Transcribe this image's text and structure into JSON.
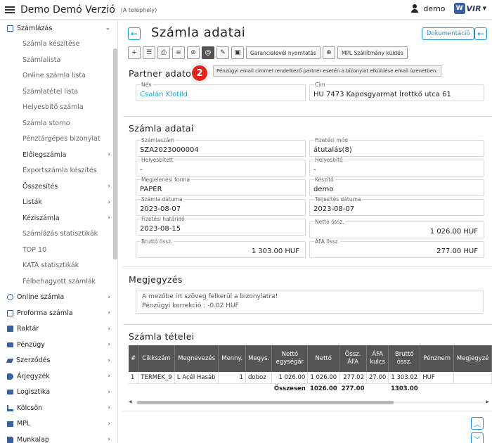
{
  "header": {
    "title": "Demo Demó Verzió",
    "subtitle": "(A telephely)",
    "user": "demo",
    "logo_text": "VIR",
    "logo_letter": "W"
  },
  "sidebar": {
    "items": [
      {
        "label": "Számlázás",
        "icon": "document-icon",
        "chevron": "⌄",
        "type": "main"
      },
      {
        "label": "Számla készítése",
        "type": "sub"
      },
      {
        "label": "Számlalista",
        "type": "sub"
      },
      {
        "label": "Online számla lista",
        "type": "sub"
      },
      {
        "label": "Számlatétel lista",
        "type": "sub"
      },
      {
        "label": "Helyesbítő számla",
        "type": "sub"
      },
      {
        "label": "Számla storno",
        "type": "sub"
      },
      {
        "label": "Pénztárgépes bizonylat",
        "type": "sub"
      },
      {
        "label": "Előlegszámla",
        "chevron": "›",
        "type": "subbold"
      },
      {
        "label": "Exportszámla készítés",
        "type": "sub"
      },
      {
        "label": "Összesítés",
        "chevron": "›",
        "type": "subbold"
      },
      {
        "label": "Listák",
        "chevron": "›",
        "type": "subbold"
      },
      {
        "label": "Kéziszámla",
        "chevron": "›",
        "type": "subbold"
      },
      {
        "label": "Számlázás statisztikák",
        "type": "sub"
      },
      {
        "label": "TOP 10",
        "type": "sub"
      },
      {
        "label": "KATA statisztikák",
        "type": "sub"
      },
      {
        "label": "Félbehagyott számlák",
        "type": "sub"
      },
      {
        "label": "Online számla",
        "icon": "globe-icon",
        "chevron": "›",
        "type": "main"
      },
      {
        "label": "Proforma számla",
        "icon": "document-icon",
        "chevron": "›",
        "type": "main"
      },
      {
        "label": "Raktár",
        "icon": "warehouse-icon",
        "chevron": "›",
        "type": "main"
      },
      {
        "label": "Pénzügy",
        "icon": "money-icon",
        "chevron": "›",
        "type": "main"
      },
      {
        "label": "Szerződés",
        "icon": "pen-icon",
        "chevron": "›",
        "type": "main"
      },
      {
        "label": "Árjegyzék",
        "icon": "tag-icon",
        "chevron": "›",
        "type": "main"
      },
      {
        "label": "Logisztika",
        "icon": "truck-icon",
        "chevron": "›",
        "type": "main"
      },
      {
        "label": "Kölcsön",
        "icon": "hand-icon",
        "chevron": "›",
        "type": "main"
      },
      {
        "label": "MPL",
        "icon": "map-icon",
        "chevron": "›",
        "type": "main"
      },
      {
        "label": "Munkalap",
        "icon": "folder-icon",
        "chevron": "›",
        "type": "main"
      }
    ]
  },
  "page": {
    "title": "Számla adatai",
    "doc_button": "Dokumentáció",
    "back_arrow": "←",
    "toolbar": {
      "plus": "+",
      "list": "☰",
      "print": "⎙",
      "numbered": "≡",
      "cancel": "⊘",
      "email": "@",
      "edit": "✎",
      "money": "▣",
      "guarantee": "Garancialevél nyomtatás",
      "globe": "⊕",
      "mpl": "MPL Szállítmány küldés"
    },
    "tooltip": "Pénzügyi email címmel rendelkező partner esetén a bizonylat elküldése email üzenetben.",
    "badge": "2"
  },
  "partner": {
    "title": "Partner adato",
    "name_label": "Név",
    "name": "Csalán Klotild",
    "address_label": "Cím",
    "address": "HU 7473 Kaposgyarmat Írottkő utca 61"
  },
  "invoice": {
    "title": "Számla adatai",
    "fields": {
      "szamlaszam_label": "Számlaszám",
      "szamlaszam": "SZA2023000004",
      "fizetesi_mod_label": "Fizetési mód",
      "fizetesi_mod": "átutalás(8)",
      "helyesbitett_label": "Helyesbített",
      "helyesbitett": "-",
      "helyesbito_label": "Helyesbítő",
      "helyesbito": "-",
      "megjelenesi_label": "Megjelenési forma",
      "megjelenesi": "PAPER",
      "keszito_label": "Készítő",
      "keszito": "demo",
      "datum_label": "Számla dátuma",
      "datum": "2023-08-07",
      "teljesites_label": "Teljesítés dátuma",
      "teljesites": "2023-08-07",
      "hatarido_label": "Fizetési határidő",
      "hatarido": "2023-08-15",
      "netto_label": "Nettó össz.",
      "netto": "1 026.00 HUF",
      "brutto_label": "Bruttó össz.",
      "brutto": "1 303.00 HUF",
      "afa_label": "ÁFA össz.",
      "afa": "277.00 HUF"
    }
  },
  "notes": {
    "title": "Megjegyzés",
    "line1": "A mezőbe írt szöveg felkerül a bizonylatra!",
    "line2": "Pénzügyi korrekció : -0.02 HUF"
  },
  "items": {
    "title": "Számla tételei",
    "headers": [
      "#",
      "Cikkszám",
      "Megnevezés",
      "Menny.",
      "Megys.",
      "Nettó egységár",
      "Nettó",
      "Össz. ÁFA",
      "ÁFA kulcs",
      "Bruttó össz.",
      "Pénznem",
      "Megjegyzé"
    ],
    "rows": [
      [
        "1",
        "TERMEK_9",
        "L Acél Hasáb",
        "1",
        "doboz",
        "1 026.00",
        "1 026.00",
        "277.02",
        "27.00",
        "1 303.02",
        "HUF",
        ""
      ]
    ],
    "sum": {
      "label": "Összesen",
      "netto": "1026.00",
      "afa": "277.00",
      "brutto": "1303.00"
    }
  }
}
